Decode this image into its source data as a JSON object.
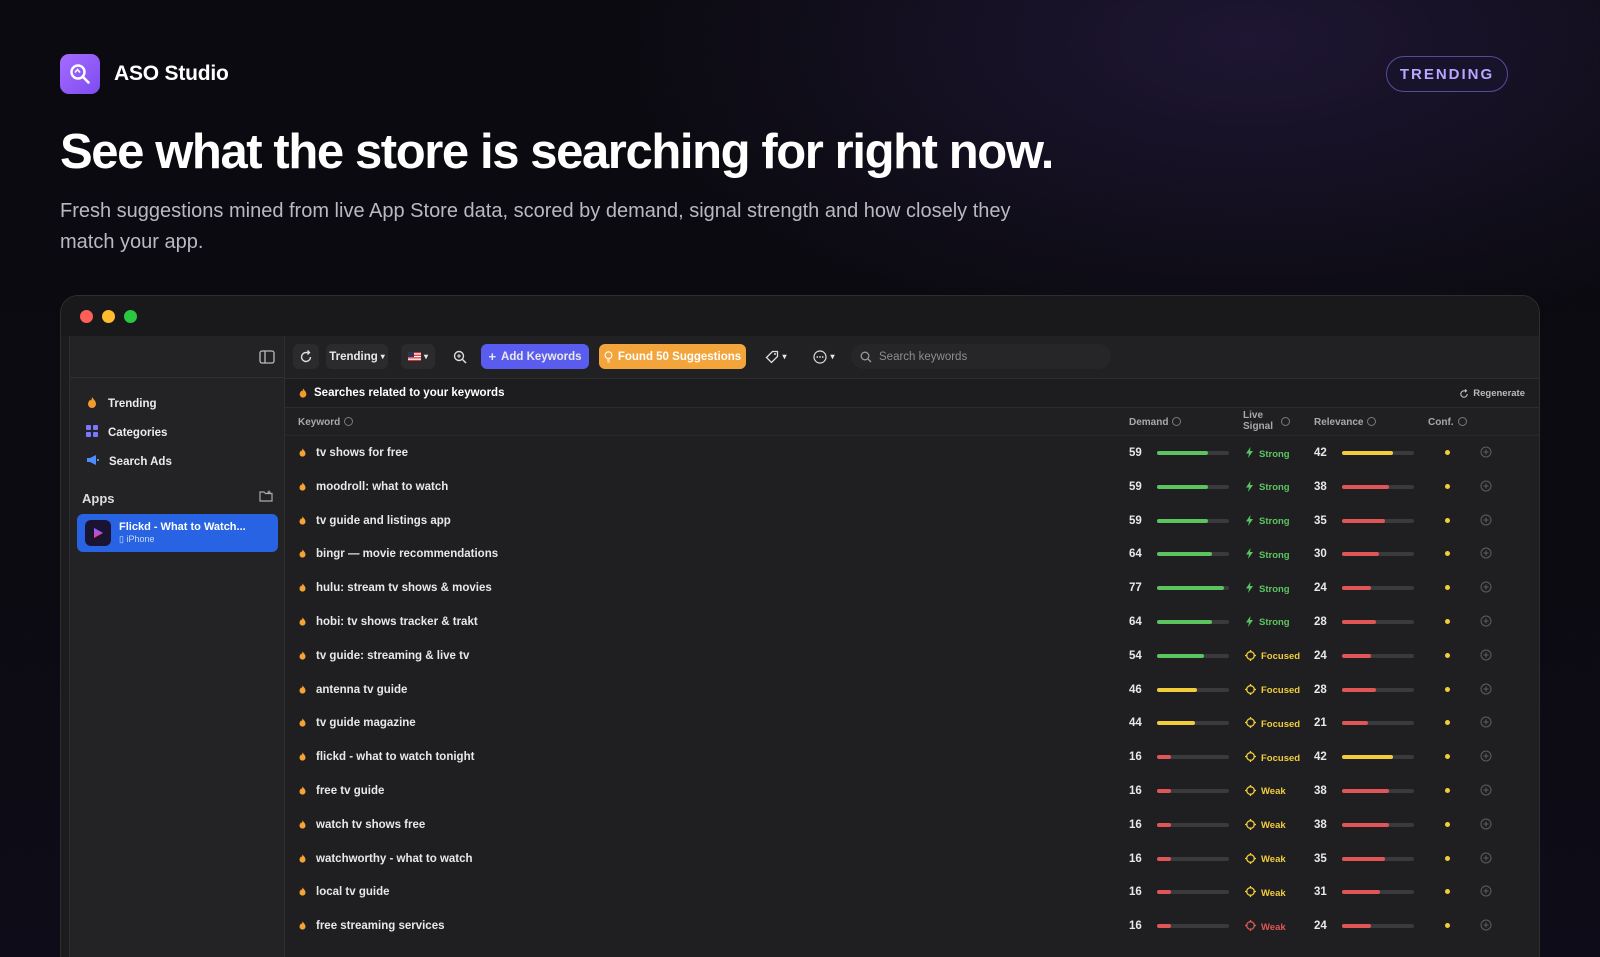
{
  "brand": {
    "name": "ASO Studio",
    "badge": "TRENDING"
  },
  "hero": {
    "headline": "See what the store is searching for right now.",
    "subhead": "Fresh suggestions mined from live App Store data, scored by demand, signal strength and how closely they match your app."
  },
  "sidebar": {
    "items": [
      {
        "label": "Trending",
        "icon": "flame-icon"
      },
      {
        "label": "Categories",
        "icon": "grid-icon"
      },
      {
        "label": "Search Ads",
        "icon": "megaphone-icon"
      }
    ],
    "apps_label": "Apps",
    "app": {
      "name": "Flickd - What to Watch...",
      "platform": "iPhone"
    }
  },
  "toolbar": {
    "mode": "Trending",
    "add_keywords": "Add Keywords",
    "found": "Found 50 Suggestions",
    "search_placeholder": "Search keywords"
  },
  "subbar": {
    "title": "Searches related to your keywords",
    "regenerate": "Regenerate"
  },
  "columns": {
    "keyword": "Keyword",
    "demand": "Demand",
    "live_signal": "Live Signal",
    "relevance": "Relevance",
    "conf": "Conf."
  },
  "colors": {
    "green": "#5bc45f",
    "yellow": "#f1cd3a",
    "red": "#e05656",
    "orange": "#f5a236",
    "accent_blue": "#5a5cf0"
  },
  "rows": [
    {
      "keyword": "tv shows for free",
      "demand": 59,
      "signal": "Strong",
      "relevance": 42
    },
    {
      "keyword": "moodroll: what to watch",
      "demand": 59,
      "signal": "Strong",
      "relevance": 38
    },
    {
      "keyword": "tv guide and listings app",
      "demand": 59,
      "signal": "Strong",
      "relevance": 35
    },
    {
      "keyword": "bingr — movie recommendations",
      "demand": 64,
      "signal": "Strong",
      "relevance": 30
    },
    {
      "keyword": "hulu: stream tv shows & movies",
      "demand": 77,
      "signal": "Strong",
      "relevance": 24
    },
    {
      "keyword": "hobi: tv shows tracker & trakt",
      "demand": 64,
      "signal": "Strong",
      "relevance": 28
    },
    {
      "keyword": "tv guide: streaming & live tv",
      "demand": 54,
      "signal": "Focused",
      "relevance": 24
    },
    {
      "keyword": "antenna tv guide",
      "demand": 46,
      "signal": "Focused",
      "relevance": 28
    },
    {
      "keyword": "tv guide magazine",
      "demand": 44,
      "signal": "Focused",
      "relevance": 21
    },
    {
      "keyword": "flickd - what to watch tonight",
      "demand": 16,
      "signal": "Focused",
      "relevance": 42
    },
    {
      "keyword": "free tv guide",
      "demand": 16,
      "signal": "Weak",
      "relevance": 38
    },
    {
      "keyword": "watch tv shows free",
      "demand": 16,
      "signal": "Weak",
      "relevance": 38
    },
    {
      "keyword": "watchworthy - what to watch",
      "demand": 16,
      "signal": "Weak",
      "relevance": 35
    },
    {
      "keyword": "local tv guide",
      "demand": 16,
      "signal": "Weak",
      "relevance": 31
    },
    {
      "keyword": "free streaming services",
      "demand": 16,
      "signal": "Weak",
      "relevance": 24
    }
  ]
}
